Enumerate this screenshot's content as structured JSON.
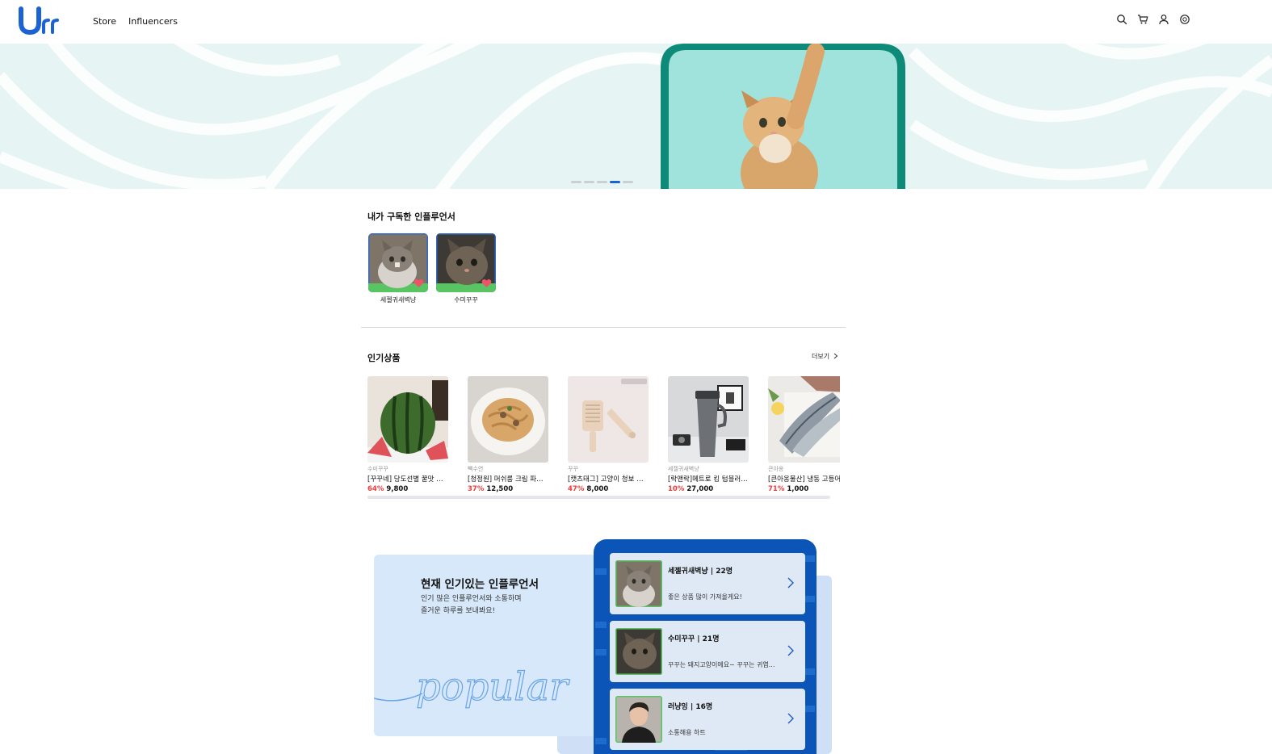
{
  "header": {
    "logo_text": "Urr",
    "nav": [
      "Store",
      "Influencers"
    ],
    "icons": [
      "search-icon",
      "cart-icon",
      "user-icon",
      "coin-icon"
    ],
    "accent": "#1b63d4"
  },
  "hero": {
    "slides_total": 5,
    "active_slide": 4,
    "bg_color": "#e6f5f4",
    "arch_color": "#0e8a78"
  },
  "subscribed": {
    "title": "내가 구독한 인플루언서",
    "items": [
      {
        "name": "세젤귀새벽냥"
      },
      {
        "name": "수미꾸꾸"
      }
    ]
  },
  "popular_products": {
    "title": "인기상품",
    "more_label": "더보기",
    "items": [
      {
        "seller": "수미꾸꾸",
        "name": "[꾸꾸네] 당도선별 꿀맛 수박",
        "discount": "64%",
        "price": "9,800"
      },
      {
        "seller": "빽수연",
        "name": "[청정원] 머쉬룸 크림 파스타",
        "discount": "37%",
        "price": "12,500"
      },
      {
        "seller": "꾸꾸",
        "name": "[캣츠태그] 고양이 청보 모...",
        "discount": "47%",
        "price": "8,000"
      },
      {
        "seller": "세젤귀새벽냥",
        "name": "[락앤락]메트로 킹 텀블러 ...",
        "discount": "10%",
        "price": "27,000"
      },
      {
        "seller": "큰아옹",
        "name": "[큰아옹물산] 냉동 고등어",
        "discount": "71%",
        "price": "1,000"
      }
    ],
    "discount_color": "#ef3b3b"
  },
  "popular_influencers": {
    "title": "현재 인기있는 인플루언서",
    "desc_lines": [
      "인기 많은 인플루언서와 소통하며",
      "즐거운 하루를 보내봐요!"
    ],
    "script_word": "popular",
    "items": [
      {
        "name": "세젤귀새벽냥 | 22명",
        "message": "좋은 상품 많이 가져올게요!"
      },
      {
        "name": "수미꾸꾸 | 21명",
        "message": "꾸꾸는 돼지고양이에요~ 꾸꾸는 귀엽..."
      },
      {
        "name": "러냥잉 | 16명",
        "message": "소통해용 하트"
      }
    ],
    "panel_color": "#0b55b8"
  }
}
